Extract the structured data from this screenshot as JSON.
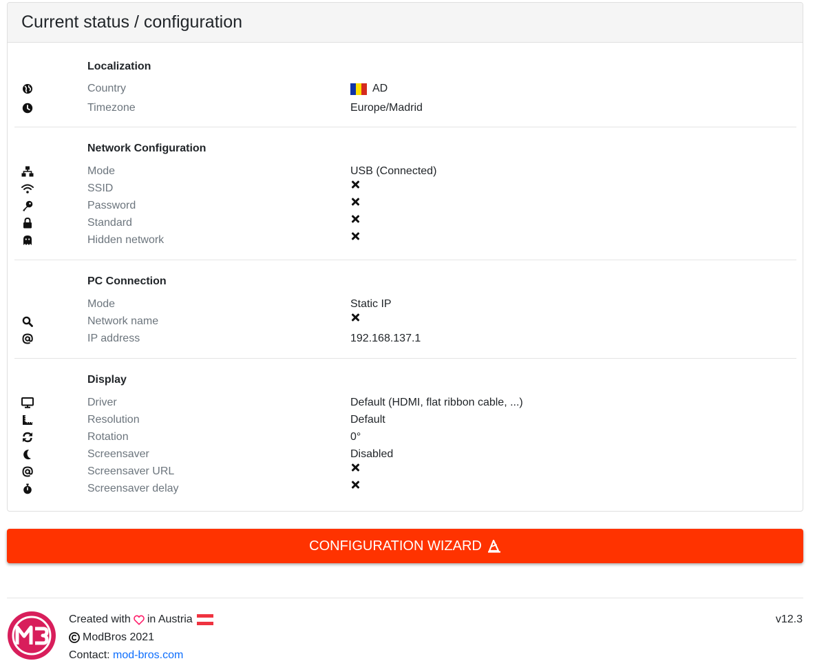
{
  "card": {
    "title": "Current status / configuration"
  },
  "sections": {
    "localization": {
      "title": "Localization",
      "rows": [
        {
          "label": "Country",
          "value": "AD",
          "icon": "globe-icon"
        },
        {
          "label": "Timezone",
          "value": "Europe/Madrid",
          "icon": "clock-icon"
        }
      ]
    },
    "network": {
      "title": "Network Configuration",
      "rows": [
        {
          "label": "Mode",
          "value": "USB (Connected)",
          "icon": "network-icon"
        },
        {
          "label": "SSID",
          "value": "",
          "icon": "wifi-icon",
          "status": "not-set"
        },
        {
          "label": "Password",
          "value": "",
          "icon": "key-icon",
          "status": "not-set"
        },
        {
          "label": "Standard",
          "value": "",
          "icon": "lock-icon",
          "status": "not-set"
        },
        {
          "label": "Hidden network",
          "value": "",
          "icon": "ghost-icon",
          "status": "not-set"
        }
      ]
    },
    "pc": {
      "title": "PC Connection",
      "rows": [
        {
          "label": "Mode",
          "value": "Static IP",
          "icon": ""
        },
        {
          "label": "Network name",
          "value": "",
          "icon": "search-icon",
          "status": "not-set"
        },
        {
          "label": "IP address",
          "value": "192.168.137.1",
          "icon": "at-icon"
        }
      ]
    },
    "display": {
      "title": "Display",
      "rows": [
        {
          "label": "Driver",
          "value": "Default (HDMI, flat ribbon cable, ...)",
          "icon": "monitor-icon"
        },
        {
          "label": "Resolution",
          "value": "Default",
          "icon": "ruler-icon"
        },
        {
          "label": "Rotation",
          "value": "0°",
          "icon": "rotate-icon"
        },
        {
          "label": "Screensaver",
          "value": "Disabled",
          "icon": "moon-icon"
        },
        {
          "label": "Screensaver URL",
          "value": "",
          "icon": "at-icon",
          "status": "not-set"
        },
        {
          "label": "Screensaver delay",
          "value": "",
          "icon": "stopwatch-icon",
          "status": "not-set"
        }
      ]
    }
  },
  "wizard_button": {
    "label": "CONFIGURATION WIZARD",
    "color": "#ff3300"
  },
  "footer": {
    "created_prefix": "Created with",
    "created_suffix": "in Austria",
    "copyright": "ModBros 2021",
    "contact_label": "Contact:",
    "contact_link": "mod-bros.com",
    "version": "v12.3",
    "logo_text": "M3"
  },
  "colors": {
    "accent": "#ff3300",
    "link": "#0d6efd",
    "heart": "#ff1f6b",
    "logo": "#e0245e"
  }
}
